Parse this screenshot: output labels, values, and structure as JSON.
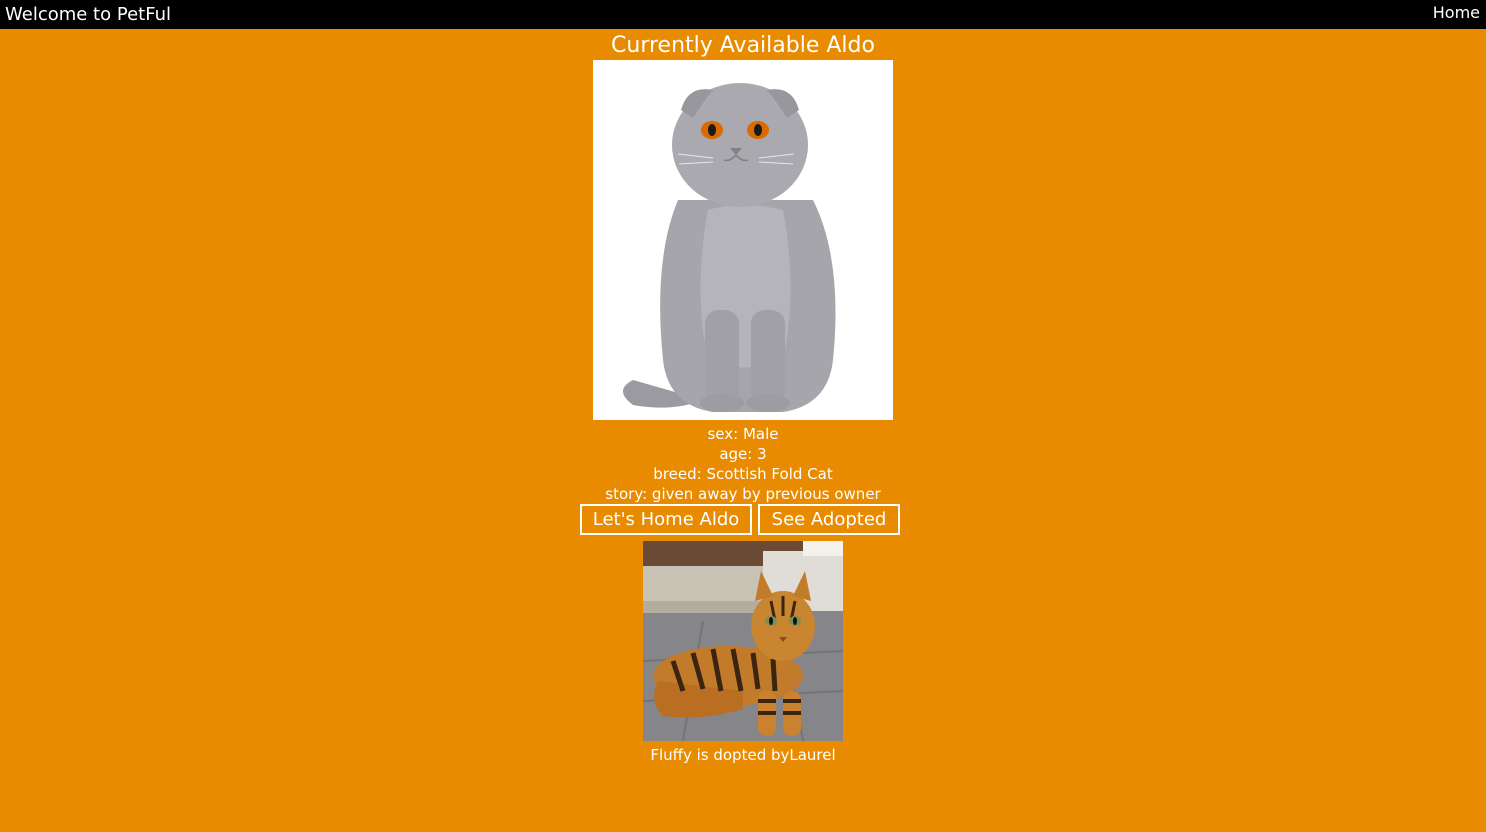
{
  "header": {
    "brand": "Welcome to PetFul",
    "nav_home": "Home"
  },
  "main": {
    "title": "Currently Available Aldo",
    "pet": {
      "sex_line": "sex: Male",
      "age_line": "age: 3",
      "breed_line": "breed: Scottish Fold Cat",
      "story_line": "story: given away by previous owner"
    },
    "buttons": {
      "adopt_label": "Let's Home Aldo",
      "see_adopted_label": "See Adopted"
    },
    "adopted": {
      "caption": "Fluffy is dopted byLaurel"
    }
  },
  "colors": {
    "page_background": "#E88B00",
    "topbar_background": "#000000",
    "text": "#FFFFFF"
  }
}
